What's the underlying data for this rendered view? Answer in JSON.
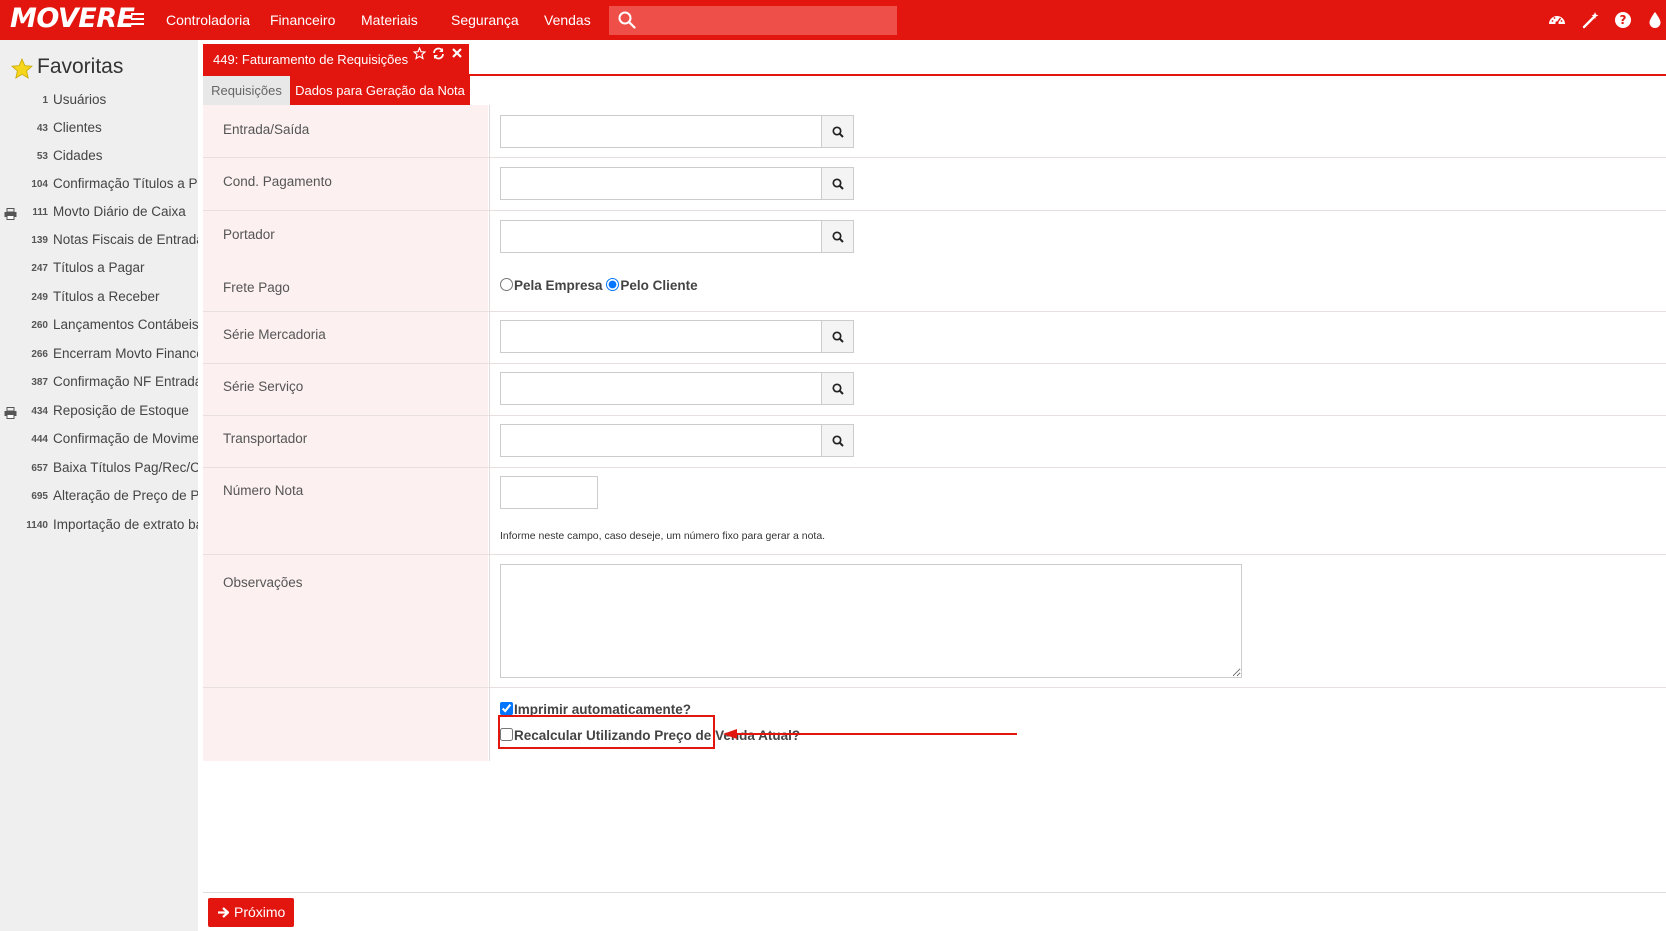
{
  "app": {
    "logo": "MOVERE",
    "nav": [
      "Controladoria",
      "Financeiro",
      "Materiais",
      "Segurança",
      "Vendas"
    ],
    "search_value": ""
  },
  "sidebar": {
    "title": "Favoritas",
    "items": [
      {
        "num": "1",
        "label": "Usuários",
        "print": false
      },
      {
        "num": "43",
        "label": "Clientes",
        "print": false
      },
      {
        "num": "53",
        "label": "Cidades",
        "print": false
      },
      {
        "num": "104",
        "label": "Confirmação Títulos a Pa",
        "print": false
      },
      {
        "num": "111",
        "label": "Movto Diário de Caixa",
        "print": true
      },
      {
        "num": "139",
        "label": "Notas Fiscais de Entrada",
        "print": false
      },
      {
        "num": "247",
        "label": "Títulos a Pagar",
        "print": false
      },
      {
        "num": "249",
        "label": "Títulos a Receber",
        "print": false
      },
      {
        "num": "260",
        "label": "Lançamentos Contábeis",
        "print": false
      },
      {
        "num": "266",
        "label": "Encerram Movto Finance",
        "print": false
      },
      {
        "num": "387",
        "label": "Confirmação NF Entrada",
        "print": false
      },
      {
        "num": "434",
        "label": "Reposição de Estoque",
        "print": true
      },
      {
        "num": "444",
        "label": "Confirmação de Movimer",
        "print": false
      },
      {
        "num": "657",
        "label": "Baixa Títulos Pag/Rec/Ch",
        "print": false
      },
      {
        "num": "695",
        "label": "Alteração de Preço de Pe",
        "print": false
      },
      {
        "num": "1140",
        "label": "Importação de extrato ba",
        "print": false
      }
    ]
  },
  "doc_tab": {
    "title": "449: Faturamento de Requisições"
  },
  "sub_tabs": {
    "requisicoes": "Requisições",
    "dados": "Dados para Geração da Nota"
  },
  "form": {
    "entrada_saida": {
      "label": "Entrada/Saída",
      "value": ""
    },
    "cond_pagamento": {
      "label": "Cond. Pagamento",
      "value": ""
    },
    "portador": {
      "label": "Portador",
      "value": ""
    },
    "frete_pago": {
      "label": "Frete Pago",
      "option_empresa": "Pela Empresa",
      "option_cliente": "Pelo Cliente",
      "selected": "Pelo Cliente"
    },
    "serie_mercadoria": {
      "label": "Série Mercadoria",
      "value": ""
    },
    "serie_servico": {
      "label": "Série Serviço",
      "value": ""
    },
    "transportador": {
      "label": "Transportador",
      "value": ""
    },
    "numero_nota": {
      "label": "Número Nota",
      "value": "",
      "hint": "Informe neste campo, caso deseje, um número fixo para gerar a nota."
    },
    "observacoes": {
      "label": "Observações",
      "value": ""
    },
    "imprimir": {
      "label": "Imprimir automaticamente?",
      "checked": true
    },
    "recalcular": {
      "label": "Recalcular Utilizando Preço de Venda Atual?",
      "checked": false
    }
  },
  "footer": {
    "next_label": "Próximo"
  },
  "colors": {
    "brand_red": "#e3150f",
    "label_bg": "#fcf0f0",
    "sidebar_bg": "#efefef"
  }
}
